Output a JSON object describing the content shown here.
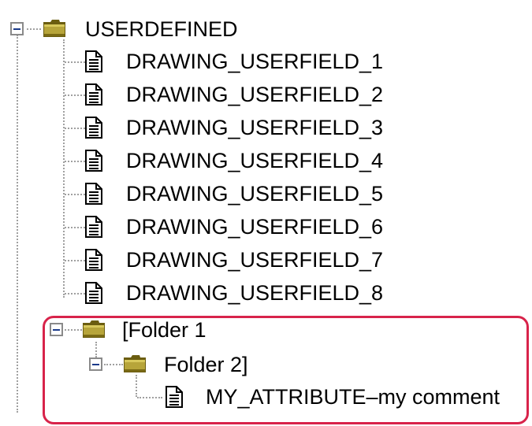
{
  "tree": {
    "root": {
      "label": "USERDEFINED",
      "expanded": true,
      "icon": "folder-icon",
      "children": [
        {
          "label": "DRAWING_USERFIELD_1",
          "icon": "document-icon"
        },
        {
          "label": "DRAWING_USERFIELD_2",
          "icon": "document-icon"
        },
        {
          "label": "DRAWING_USERFIELD_3",
          "icon": "document-icon"
        },
        {
          "label": "DRAWING_USERFIELD_4",
          "icon": "document-icon"
        },
        {
          "label": "DRAWING_USERFIELD_5",
          "icon": "document-icon"
        },
        {
          "label": "DRAWING_USERFIELD_6",
          "icon": "document-icon"
        },
        {
          "label": "DRAWING_USERFIELD_7",
          "icon": "document-icon"
        },
        {
          "label": "DRAWING_USERFIELD_8",
          "icon": "document-icon"
        }
      ]
    },
    "folder1": {
      "label": "[Folder 1",
      "expanded": true,
      "icon": "folder-icon"
    },
    "folder2": {
      "label": "Folder 2]",
      "expanded": true,
      "icon": "folder-icon"
    },
    "attribute": {
      "label": "MY_ATTRIBUTE–my comment",
      "icon": "document-icon"
    }
  },
  "colors": {
    "highlight_border": "#d8234a",
    "connector": "#a0a0a0",
    "folder": "#8a7a1a"
  }
}
